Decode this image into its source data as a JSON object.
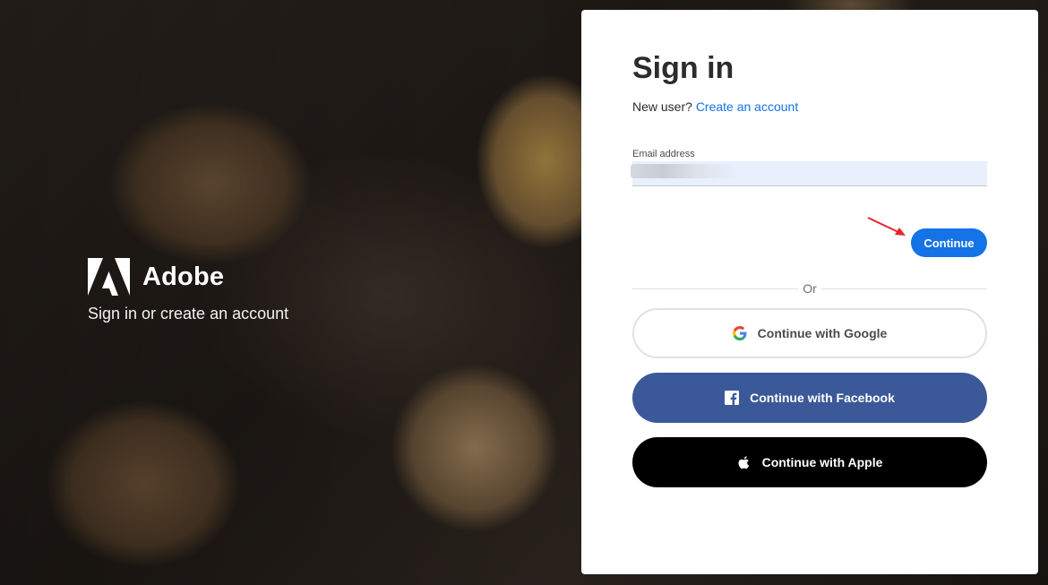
{
  "brand": {
    "name": "Adobe",
    "tagline": "Sign in or create an account"
  },
  "signin": {
    "title": "Sign in",
    "new_user_prompt": "New user?",
    "create_account_link": "Create an account",
    "email_label": "Email address",
    "email_value": "",
    "continue_label": "Continue",
    "divider_text": "Or"
  },
  "social": {
    "google_label": "Continue with Google",
    "facebook_label": "Continue with Facebook",
    "apple_label": "Continue with Apple"
  },
  "colors": {
    "accent": "#1473e6",
    "facebook": "#3b5998",
    "apple": "#000000",
    "annotation_arrow": "#e8262a"
  },
  "icons": [
    "adobe-logo-icon",
    "google-icon",
    "facebook-icon",
    "apple-icon",
    "annotation-arrow-icon"
  ]
}
